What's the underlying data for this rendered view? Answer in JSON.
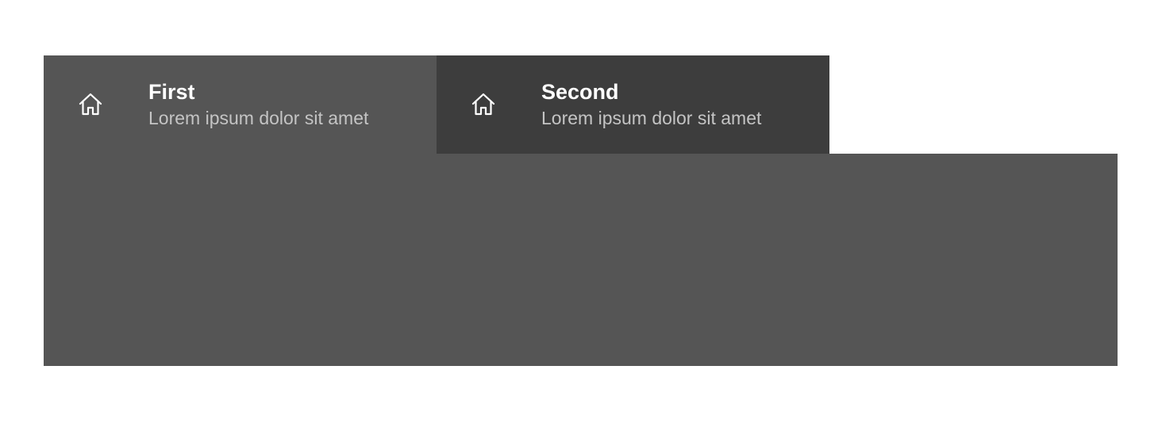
{
  "tabs": [
    {
      "title": "First",
      "subtitle": "Lorem ipsum dolor sit amet",
      "icon": "home-icon",
      "active": true
    },
    {
      "title": "Second",
      "subtitle": "Lorem ipsum dolor sit amet",
      "icon": "home-icon",
      "active": false
    }
  ],
  "colors": {
    "active_tab": "#555555",
    "inactive_tab": "#3d3d3d",
    "panel": "#555555",
    "title": "#ffffff",
    "subtitle": "#c4c4c4"
  }
}
